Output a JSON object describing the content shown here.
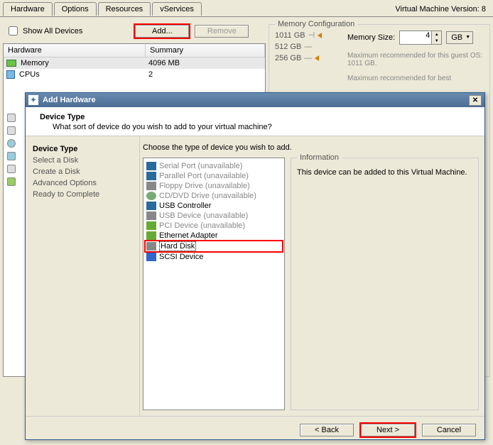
{
  "tabs": [
    "Hardware",
    "Options",
    "Resources",
    "vServices"
  ],
  "version": "Virtual Machine Version: 8",
  "show_all": "Show All Devices",
  "add_btn": "Add...",
  "remove_btn": "Remove",
  "hw_headers": [
    "Hardware",
    "Summary"
  ],
  "hw_rows": [
    {
      "name": "Memory",
      "summary": "4096 MB"
    },
    {
      "name": "CPUs",
      "summary": "2"
    }
  ],
  "memconf": {
    "legend": "Memory Configuration",
    "ticks": [
      "1011 GB",
      "512 GB",
      "256 GB"
    ],
    "size_label": "Memory Size:",
    "size_value": "4",
    "unit": "GB",
    "rec1": "Maximum recommended for this guest OS: 1011 GB.",
    "rec2": "Maximum recommended for best"
  },
  "dialog": {
    "title": "Add Hardware",
    "dev_type": "Device Type",
    "question": "What sort of device do you wish to add to your virtual machine?",
    "steps": [
      "Device Type",
      "Select a Disk",
      "Create a Disk",
      "Advanced Options",
      "Ready to Complete"
    ],
    "prompt": "Choose the type of device you wish to add.",
    "types": [
      {
        "label": "Serial Port (unavailable)",
        "avail": false,
        "ico": "serial"
      },
      {
        "label": "Parallel Port (unavailable)",
        "avail": false,
        "ico": "parallel"
      },
      {
        "label": "Floppy Drive (unavailable)",
        "avail": false,
        "ico": "floppy"
      },
      {
        "label": "CD/DVD Drive (unavailable)",
        "avail": false,
        "ico": "cd"
      },
      {
        "label": "USB Controller",
        "avail": true,
        "ico": "usb"
      },
      {
        "label": "USB Device (unavailable)",
        "avail": false,
        "ico": "usbdev"
      },
      {
        "label": "PCI Device (unavailable)",
        "avail": false,
        "ico": "pci"
      },
      {
        "label": "Ethernet Adapter",
        "avail": true,
        "ico": "eth"
      },
      {
        "label": "Hard Disk",
        "avail": true,
        "ico": "hdd",
        "selected": true
      },
      {
        "label": "SCSI Device",
        "avail": true,
        "ico": "scsi"
      }
    ],
    "info_legend": "Information",
    "info_text": "This device can be added to this Virtual Machine.",
    "back": "< Back",
    "next": "Next >",
    "cancel": "Cancel"
  }
}
